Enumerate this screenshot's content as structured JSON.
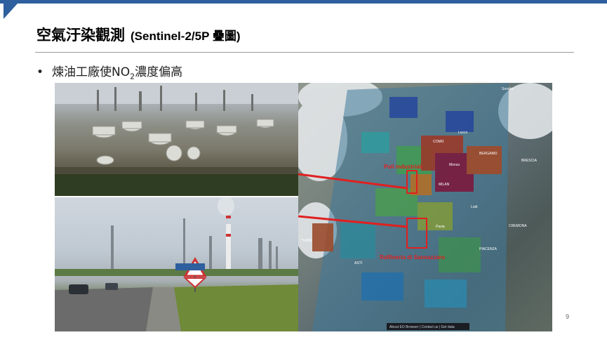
{
  "slide": {
    "title_main": "空氣汙染觀測",
    "title_sub": "(Sentinel-2/5P 疊圖)",
    "bullet": {
      "marker": "•",
      "text_before": "煉油工廠使NO",
      "subscript": "2",
      "text_after": "濃度偏高"
    },
    "page_number": "9"
  },
  "map": {
    "labels": {
      "poli": "Poli industriali",
      "raffineria": "Raffineria di Sannazzaro",
      "como": "COMO",
      "bergamo": "BERGAMO",
      "milan": "MILAN",
      "turin": "TURIN",
      "asti": "ASTI",
      "lodi": "Lodi",
      "sondrio": "Sondrio",
      "lecco": "Lecco",
      "monza": "Monza",
      "pavia": "Pavia",
      "piacenza": "PIACENZA",
      "cremona": "CREMONA",
      "brescia": "BRESCIA"
    },
    "footer": "About EO Browser | Contact us | Get data"
  },
  "colors": {
    "accent": "#2e5f9e",
    "annotation": "#e02020",
    "no2_high": "#8b1a2e",
    "no2_mid": "#2a8a3a",
    "no2_low": "#1f3f9e"
  }
}
